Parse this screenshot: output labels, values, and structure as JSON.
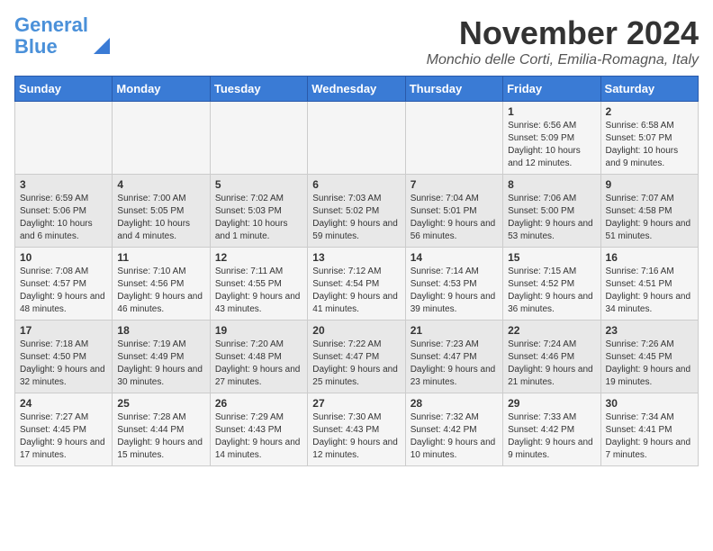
{
  "logo": {
    "line1": "General",
    "line2": "Blue"
  },
  "title": "November 2024",
  "subtitle": "Monchio delle Corti, Emilia-Romagna, Italy",
  "days_of_week": [
    "Sunday",
    "Monday",
    "Tuesday",
    "Wednesday",
    "Thursday",
    "Friday",
    "Saturday"
  ],
  "weeks": [
    [
      {
        "day": "",
        "info": ""
      },
      {
        "day": "",
        "info": ""
      },
      {
        "day": "",
        "info": ""
      },
      {
        "day": "",
        "info": ""
      },
      {
        "day": "",
        "info": ""
      },
      {
        "day": "1",
        "info": "Sunrise: 6:56 AM\nSunset: 5:09 PM\nDaylight: 10 hours and 12 minutes."
      },
      {
        "day": "2",
        "info": "Sunrise: 6:58 AM\nSunset: 5:07 PM\nDaylight: 10 hours and 9 minutes."
      }
    ],
    [
      {
        "day": "3",
        "info": "Sunrise: 6:59 AM\nSunset: 5:06 PM\nDaylight: 10 hours and 6 minutes."
      },
      {
        "day": "4",
        "info": "Sunrise: 7:00 AM\nSunset: 5:05 PM\nDaylight: 10 hours and 4 minutes."
      },
      {
        "day": "5",
        "info": "Sunrise: 7:02 AM\nSunset: 5:03 PM\nDaylight: 10 hours and 1 minute."
      },
      {
        "day": "6",
        "info": "Sunrise: 7:03 AM\nSunset: 5:02 PM\nDaylight: 9 hours and 59 minutes."
      },
      {
        "day": "7",
        "info": "Sunrise: 7:04 AM\nSunset: 5:01 PM\nDaylight: 9 hours and 56 minutes."
      },
      {
        "day": "8",
        "info": "Sunrise: 7:06 AM\nSunset: 5:00 PM\nDaylight: 9 hours and 53 minutes."
      },
      {
        "day": "9",
        "info": "Sunrise: 7:07 AM\nSunset: 4:58 PM\nDaylight: 9 hours and 51 minutes."
      }
    ],
    [
      {
        "day": "10",
        "info": "Sunrise: 7:08 AM\nSunset: 4:57 PM\nDaylight: 9 hours and 48 minutes."
      },
      {
        "day": "11",
        "info": "Sunrise: 7:10 AM\nSunset: 4:56 PM\nDaylight: 9 hours and 46 minutes."
      },
      {
        "day": "12",
        "info": "Sunrise: 7:11 AM\nSunset: 4:55 PM\nDaylight: 9 hours and 43 minutes."
      },
      {
        "day": "13",
        "info": "Sunrise: 7:12 AM\nSunset: 4:54 PM\nDaylight: 9 hours and 41 minutes."
      },
      {
        "day": "14",
        "info": "Sunrise: 7:14 AM\nSunset: 4:53 PM\nDaylight: 9 hours and 39 minutes."
      },
      {
        "day": "15",
        "info": "Sunrise: 7:15 AM\nSunset: 4:52 PM\nDaylight: 9 hours and 36 minutes."
      },
      {
        "day": "16",
        "info": "Sunrise: 7:16 AM\nSunset: 4:51 PM\nDaylight: 9 hours and 34 minutes."
      }
    ],
    [
      {
        "day": "17",
        "info": "Sunrise: 7:18 AM\nSunset: 4:50 PM\nDaylight: 9 hours and 32 minutes."
      },
      {
        "day": "18",
        "info": "Sunrise: 7:19 AM\nSunset: 4:49 PM\nDaylight: 9 hours and 30 minutes."
      },
      {
        "day": "19",
        "info": "Sunrise: 7:20 AM\nSunset: 4:48 PM\nDaylight: 9 hours and 27 minutes."
      },
      {
        "day": "20",
        "info": "Sunrise: 7:22 AM\nSunset: 4:47 PM\nDaylight: 9 hours and 25 minutes."
      },
      {
        "day": "21",
        "info": "Sunrise: 7:23 AM\nSunset: 4:47 PM\nDaylight: 9 hours and 23 minutes."
      },
      {
        "day": "22",
        "info": "Sunrise: 7:24 AM\nSunset: 4:46 PM\nDaylight: 9 hours and 21 minutes."
      },
      {
        "day": "23",
        "info": "Sunrise: 7:26 AM\nSunset: 4:45 PM\nDaylight: 9 hours and 19 minutes."
      }
    ],
    [
      {
        "day": "24",
        "info": "Sunrise: 7:27 AM\nSunset: 4:45 PM\nDaylight: 9 hours and 17 minutes."
      },
      {
        "day": "25",
        "info": "Sunrise: 7:28 AM\nSunset: 4:44 PM\nDaylight: 9 hours and 15 minutes."
      },
      {
        "day": "26",
        "info": "Sunrise: 7:29 AM\nSunset: 4:43 PM\nDaylight: 9 hours and 14 minutes."
      },
      {
        "day": "27",
        "info": "Sunrise: 7:30 AM\nSunset: 4:43 PM\nDaylight: 9 hours and 12 minutes."
      },
      {
        "day": "28",
        "info": "Sunrise: 7:32 AM\nSunset: 4:42 PM\nDaylight: 9 hours and 10 minutes."
      },
      {
        "day": "29",
        "info": "Sunrise: 7:33 AM\nSunset: 4:42 PM\nDaylight: 9 hours and 9 minutes."
      },
      {
        "day": "30",
        "info": "Sunrise: 7:34 AM\nSunset: 4:41 PM\nDaylight: 9 hours and 7 minutes."
      }
    ]
  ]
}
